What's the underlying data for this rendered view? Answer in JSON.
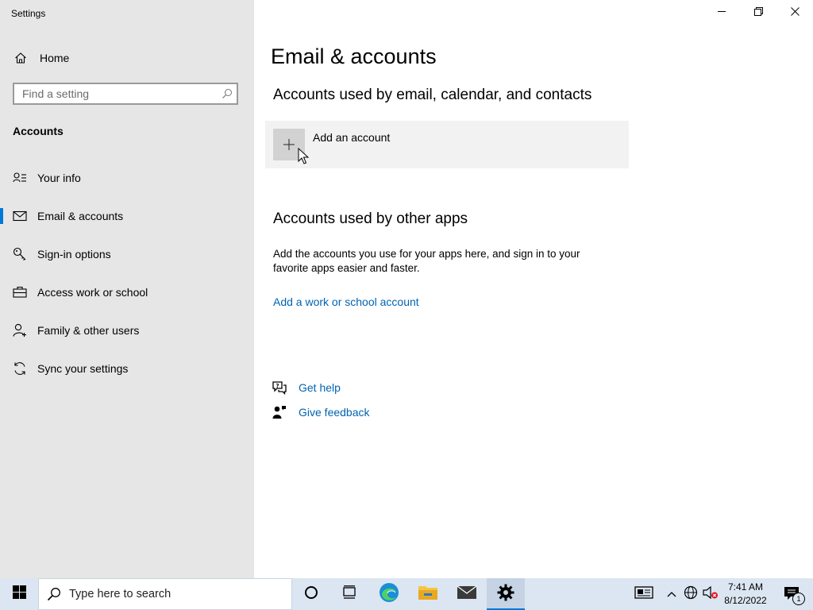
{
  "window": {
    "title": "Settings"
  },
  "sidebar": {
    "home_label": "Home",
    "search_placeholder": "Find a setting",
    "section_heading": "Accounts",
    "items": [
      {
        "label": "Your info",
        "icon": "person-info-icon",
        "active": false
      },
      {
        "label": "Email & accounts",
        "icon": "mail-icon",
        "active": true
      },
      {
        "label": "Sign-in options",
        "icon": "key-icon",
        "active": false
      },
      {
        "label": "Access work or school",
        "icon": "briefcase-icon",
        "active": false
      },
      {
        "label": "Family & other users",
        "icon": "add-person-icon",
        "active": false
      },
      {
        "label": "Sync your settings",
        "icon": "sync-icon",
        "active": false
      }
    ]
  },
  "main": {
    "title": "Email & accounts",
    "section1": {
      "heading": "Accounts used by email, calendar, and contacts",
      "add_account_label": "Add an account"
    },
    "section2": {
      "heading": "Accounts used by other apps",
      "description": "Add the accounts you use for your apps here, and sign in to your favorite apps easier and faster.",
      "link_label": "Add a work or school account"
    },
    "help": {
      "get_help": "Get help",
      "give_feedback": "Give feedback"
    }
  },
  "taskbar": {
    "search_placeholder": "Type here to search",
    "time": "7:41 AM",
    "date": "8/12/2022",
    "notification_count": "1"
  },
  "colors": {
    "accent": "#0078d7",
    "link": "#0063b1",
    "sidebar_bg": "#e6e6e6",
    "taskbar_bg": "#dce6f2"
  }
}
